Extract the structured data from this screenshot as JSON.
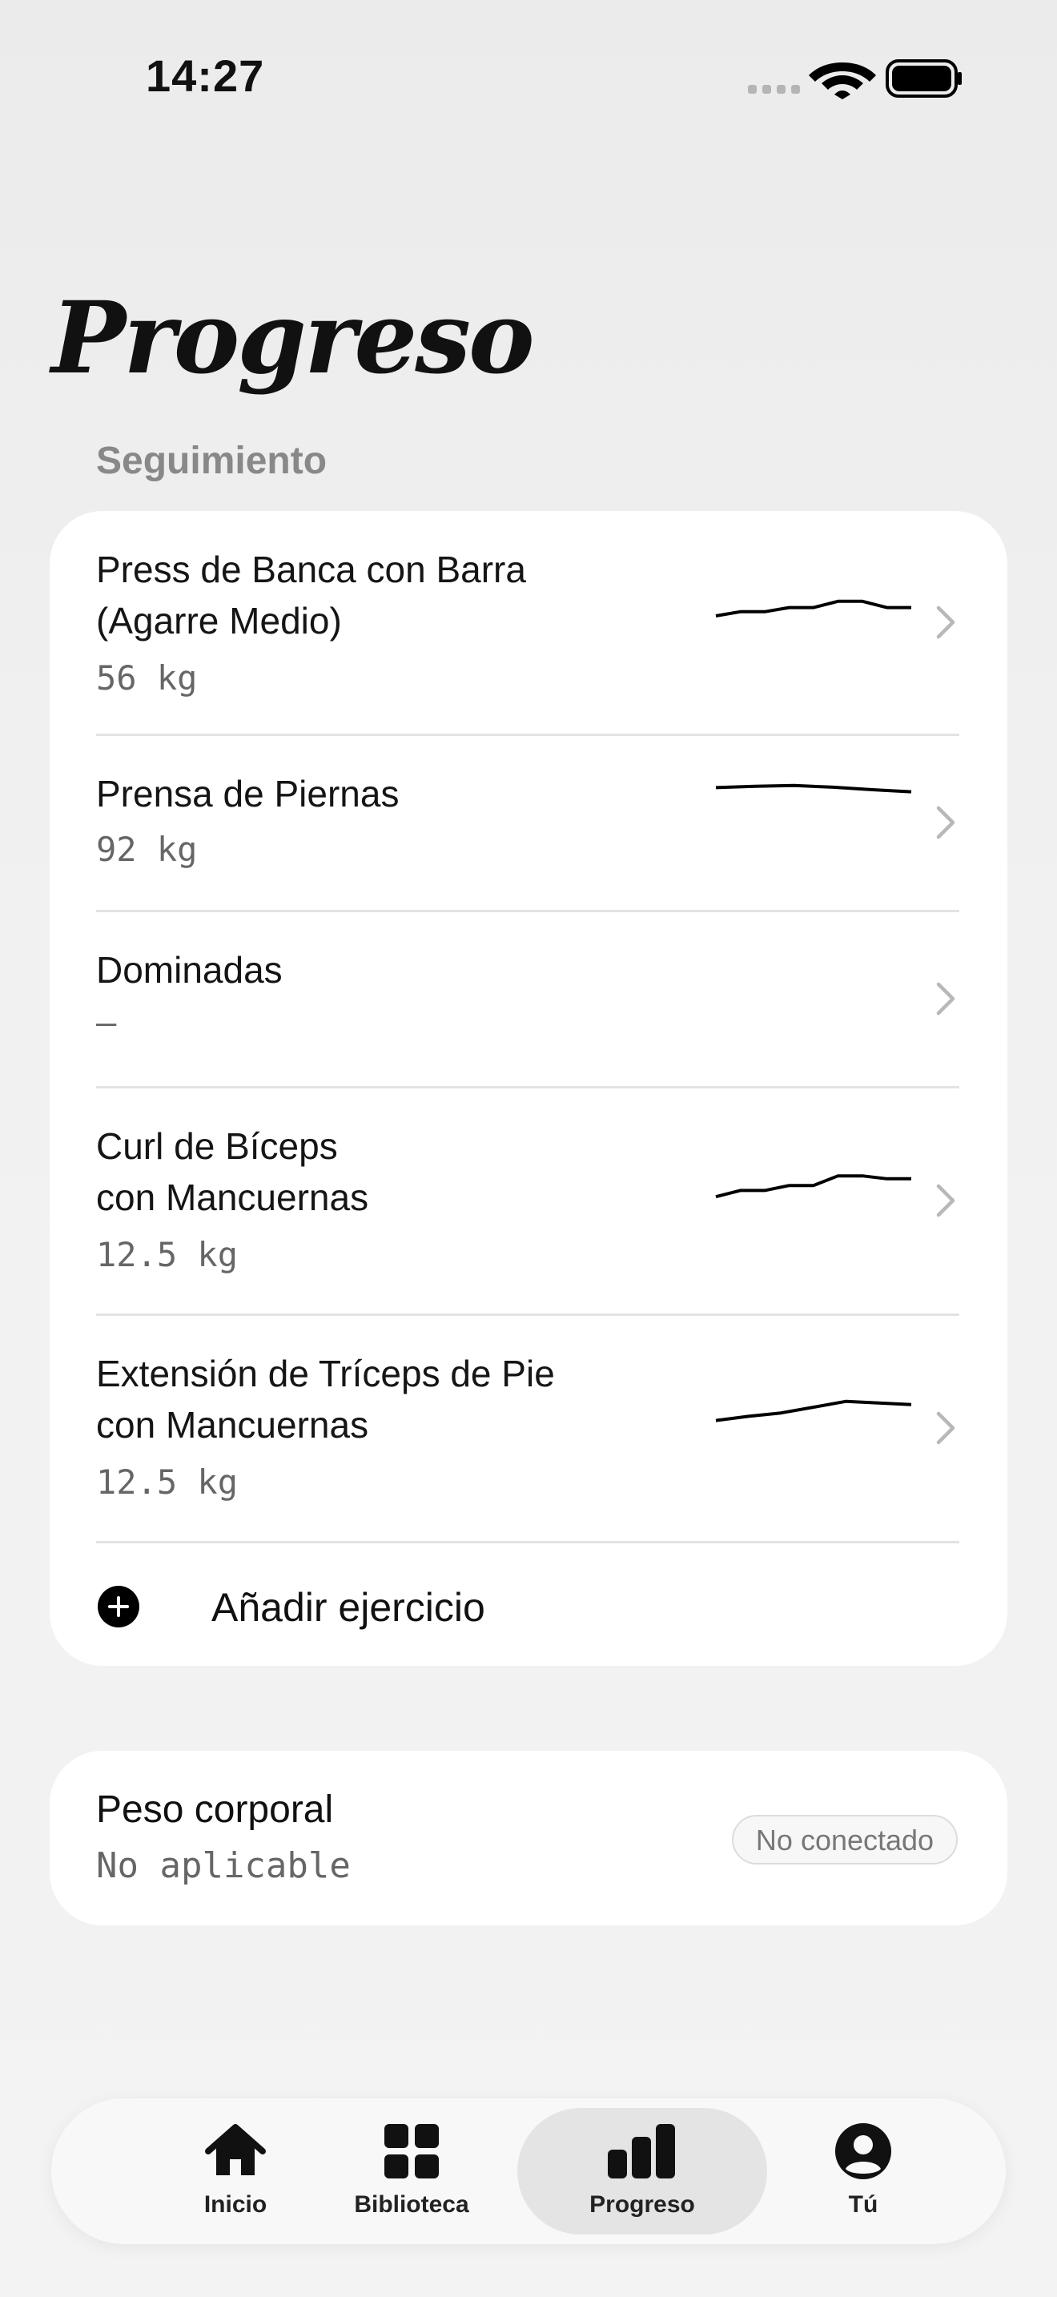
{
  "status_bar": {
    "time": "14:27"
  },
  "page": {
    "title": "Progreso",
    "section_label": "Seguimiento"
  },
  "tracking": {
    "exercises": [
      {
        "name_line1": "Press de Banca con Barra",
        "name_line2": "(Agarre Medio)",
        "value": "56 kg",
        "trend": [
          0.25,
          0.35,
          0.35,
          0.45,
          0.45,
          0.6,
          0.6,
          0.45,
          0.45
        ]
      },
      {
        "name_line1": "Prensa de Piernas",
        "name_line2": "",
        "value": "92 kg",
        "trend": [
          0.55,
          0.58,
          0.6,
          0.56,
          0.5,
          0.45
        ]
      },
      {
        "name_line1": "Dominadas",
        "name_line2": "",
        "value": "–",
        "trend": []
      },
      {
        "name_line1": "Curl de Bíceps",
        "name_line2": "con Mancuernas",
        "value": "12.5 kg",
        "trend": [
          0.15,
          0.3,
          0.3,
          0.42,
          0.42,
          0.65,
          0.65,
          0.58,
          0.58
        ]
      },
      {
        "name_line1": "Extensión de Tríceps de Pie",
        "name_line2": "con Mancuernas",
        "value": "12.5 kg",
        "trend": [
          0.2,
          0.3,
          0.38,
          0.52,
          0.66,
          0.62,
          0.58
        ]
      }
    ],
    "add_label": "Añadir ejercicio"
  },
  "body_weight": {
    "title": "Peso corporal",
    "value": "No aplicable",
    "badge": "No conectado"
  },
  "tabbar": {
    "tabs": [
      {
        "label": "Inicio",
        "icon": "home-icon",
        "active": false
      },
      {
        "label": "Biblioteca",
        "icon": "grid-icon",
        "active": false
      },
      {
        "label": "Progreso",
        "icon": "bar-chart-icon",
        "active": true
      },
      {
        "label": "Tú",
        "icon": "user-circle-icon",
        "active": false
      }
    ]
  }
}
